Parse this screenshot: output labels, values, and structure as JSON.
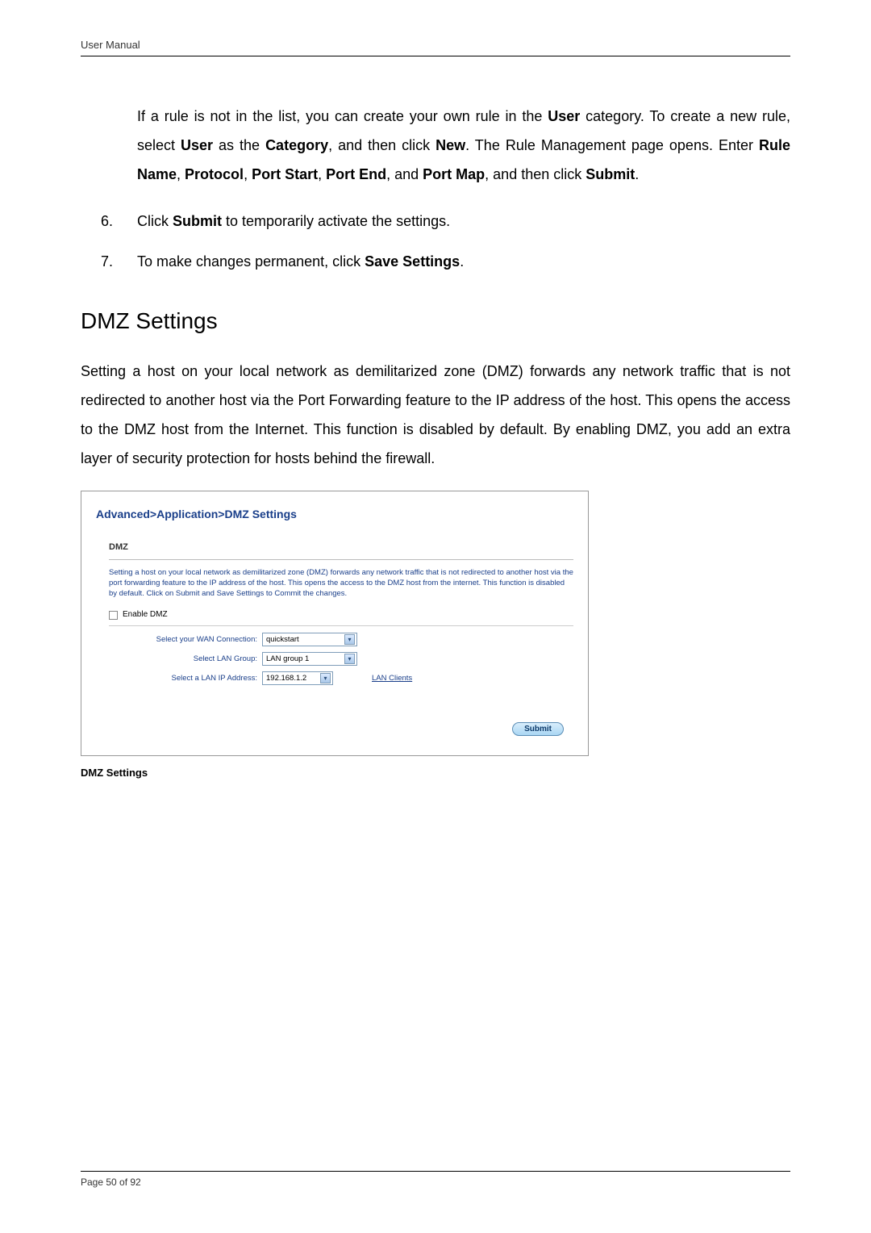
{
  "header": {
    "title": "User Manual"
  },
  "content": {
    "intro_parts": {
      "p1": "If a rule is not in the list, you can create your own rule in the ",
      "b1": "User",
      "p2": " category. To create a new rule, select ",
      "b2": "User",
      "p3": " as the ",
      "b3": "Category",
      "p4": ", and then click ",
      "b4": "New",
      "p5": ". The Rule Management page opens. Enter ",
      "b5": "Rule Name",
      "p6": ", ",
      "b6": "Protocol",
      "p7": ", ",
      "b7": "Port Start",
      "p8": ", ",
      "b8": "Port End",
      "p9": ", and ",
      "b9": "Port Map",
      "p10": ", and then click ",
      "b10": "Submit",
      "p11": "."
    },
    "steps": [
      {
        "num": "6.",
        "pre": "Click ",
        "bold": "Submit",
        "post": " to temporarily activate the settings."
      },
      {
        "num": "7.",
        "pre": "To make changes permanent, click ",
        "bold": "Save Settings",
        "post": "."
      }
    ],
    "section_title": "DMZ Settings",
    "body_para": "Setting a host on your local network as demilitarized zone (DMZ) forwards any network traffic that is not redirected to another host via the Port Forwarding feature to the IP address of the host. This opens the access to the DMZ host from the Internet. This function is disabled by default. By enabling DMZ, you add an extra layer of security protection for hosts behind the firewall."
  },
  "screenshot": {
    "breadcrumb": "Advanced>Application>DMZ Settings",
    "panel_title": "DMZ",
    "description": "Setting a host on your local network as demilitarized zone (DMZ) forwards any network traffic that is not redirected to another host via the port forwarding feature to the IP address of the host. This opens the access to the DMZ host from the internet. This function is disabled by default. Click on Submit and Save Settings to Commit the changes.",
    "enable_label": "Enable DMZ",
    "rows": {
      "wan_label": "Select your WAN Connection:",
      "wan_value": "quickstart",
      "group_label": "Select LAN Group:",
      "group_value": "LAN group 1",
      "ip_label": "Select a LAN IP Address:",
      "ip_value": "192.168.1.2",
      "lan_clients": "LAN Clients"
    },
    "submit": "Submit"
  },
  "caption": "DMZ Settings",
  "footer": {
    "page": "Page 50 of 92"
  }
}
